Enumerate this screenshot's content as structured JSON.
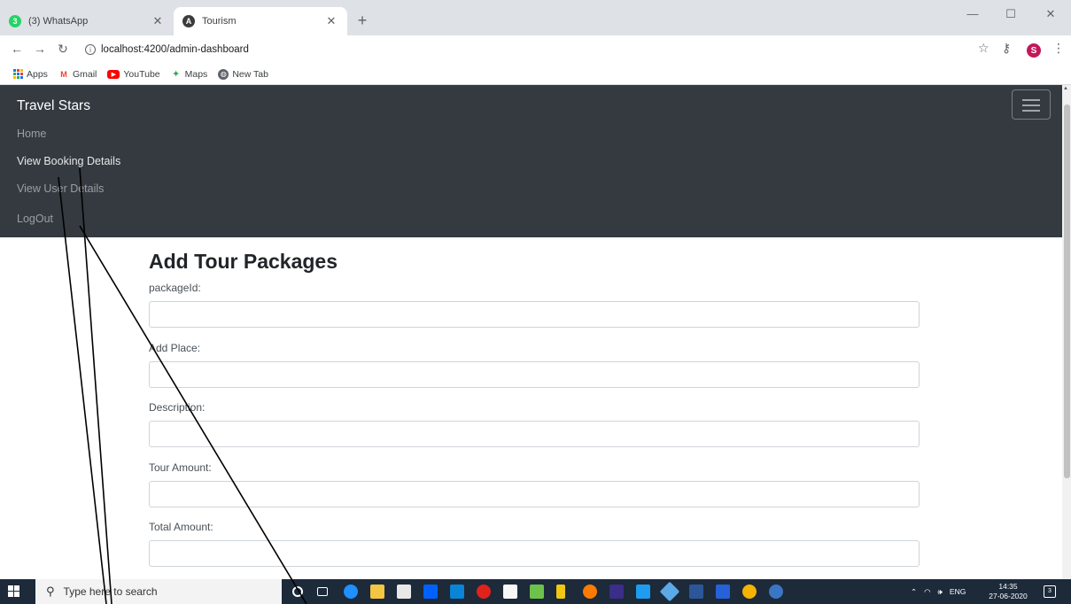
{
  "browser": {
    "tabs": [
      {
        "title": "(3) WhatsApp",
        "active": false,
        "favicon": "whatsapp-icon"
      },
      {
        "title": "Tourism",
        "active": true,
        "favicon": "angular-icon"
      }
    ],
    "new_tab": "+",
    "url": "localhost:4200/admin-dashboard",
    "avatar_letter": "S",
    "bookmarks": [
      {
        "label": "Apps",
        "icon": "apps-grid-icon"
      },
      {
        "label": "Gmail",
        "icon": "gmail-icon"
      },
      {
        "label": "YouTube",
        "icon": "youtube-icon"
      },
      {
        "label": "Maps",
        "icon": "maps-icon"
      },
      {
        "label": "New Tab",
        "icon": "globe-icon"
      }
    ]
  },
  "navbar": {
    "brand": "Travel Stars",
    "links": [
      {
        "label": "Home"
      },
      {
        "label": "View Booking Details"
      },
      {
        "label": "View User Details"
      },
      {
        "label": "LogOut"
      }
    ],
    "colors": {
      "background": "#343a40"
    }
  },
  "form": {
    "title": "Add Tour Packages",
    "fields": [
      {
        "label": "packageId:",
        "value": ""
      },
      {
        "label": "Add Place:",
        "value": ""
      },
      {
        "label": "Description:",
        "value": ""
      },
      {
        "label": "Tour Amount:",
        "value": ""
      },
      {
        "label": "Total Amount:",
        "value": ""
      }
    ]
  },
  "taskbar": {
    "search_placeholder": "Type here to search",
    "language": "ENG",
    "time": "14:35",
    "date": "27-06-2020",
    "notification_count": "3"
  }
}
